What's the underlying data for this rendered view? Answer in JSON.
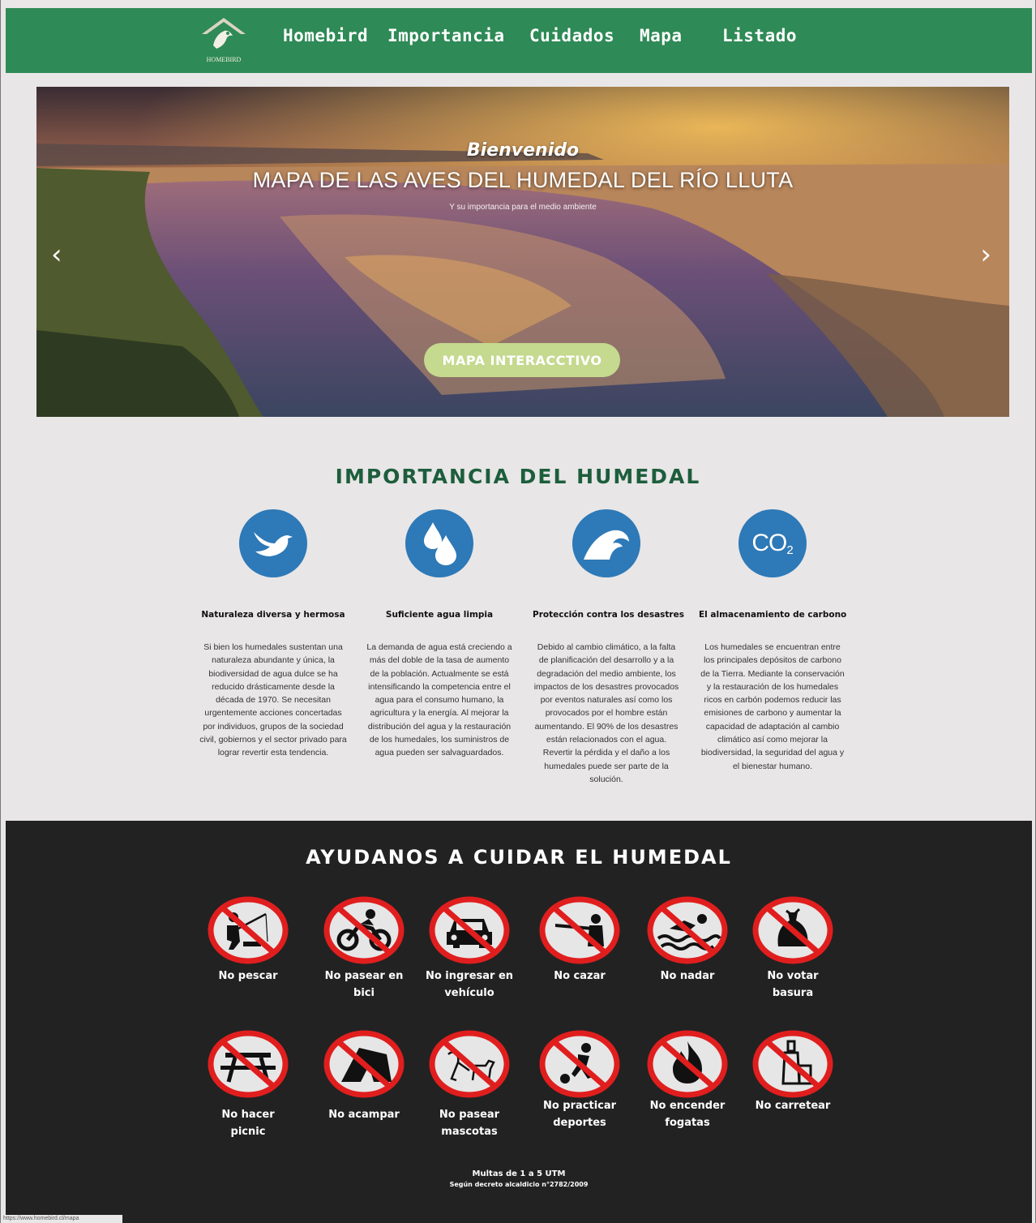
{
  "nav": {
    "logo_text": "HOMEBIRD",
    "links": [
      {
        "label": "Homebird"
      },
      {
        "label": "Importancia"
      },
      {
        "label": "Cuidados"
      },
      {
        "label": "Mapa"
      },
      {
        "label": "Listado"
      }
    ]
  },
  "hero": {
    "welcome": "Bienvenido",
    "title": "MAPA DE LAS AVES DEL HUMEDAL DEL RÍO LLUTA",
    "subtitle": "Y su importancia para el medio ambiente",
    "button": "MAPA INTERACCTIVO",
    "prev_arrow": "‹",
    "next_arrow": "›"
  },
  "importance": {
    "title": "IMPORTANCIA DEL HUMEDAL",
    "items": [
      {
        "icon": "bird-icon",
        "heading": "Naturaleza diversa y hermosa",
        "text": "Si bien los humedales sustentan una naturaleza abundante y única, la biodiversidad de agua dulce se ha reducido drásticamente desde la década de 1970. Se necesitan urgentemente acciones concertadas por individuos, grupos de la sociedad civil, gobiernos y el sector privado para lograr revertir esta tendencia."
      },
      {
        "icon": "water-drops-icon",
        "heading": "Suficiente agua limpia",
        "text": "La demanda de agua está creciendo a más del doble de la tasa de aumento de la población. Actualmente se está intensificando la competencia entre el agua para el consumo humano, la agricultura y la energía. Al mejorar la distribución del agua y la restauración de los humedales, los suministros de agua pueden ser salvaguardados."
      },
      {
        "icon": "wave-icon",
        "heading": "Protección contra los desastres",
        "text": "Debido al cambio climático, a la falta de planificación del desarrollo y a la degradación del medio ambiente, los impactos de los desastres provocados por eventos naturales así como los provocados por el hombre están aumentando. El 90% de los desastres están relacionados con el agua. Revertir la pérdida y el daño a los humedales puede ser parte de la solución."
      },
      {
        "icon": "co2-icon",
        "co2": "CO",
        "co2_sub": "2",
        "heading": "El almacenamiento de carbono",
        "text": "Los humedales se encuentran entre los principales depósitos de carbono de la Tierra. Mediante la conservación y la restauración de los humedales ricos en carbón podemos reducir las emisiones de carbono y aumentar la capacidad de adaptación al cambio climático así como mejorar la biodiversidad, la seguridad del agua y el bienestar humano."
      }
    ]
  },
  "care": {
    "title": "AYUDANOS A CUIDAR EL HUMEDAL",
    "rules": [
      {
        "icon": "no-fishing-icon",
        "line1": "No pescar",
        "line2": ""
      },
      {
        "icon": "no-bike-icon",
        "line1": "No pasear en",
        "line2": "bici"
      },
      {
        "icon": "no-vehicle-icon",
        "line1": "No ingresar en",
        "line2": "vehículo"
      },
      {
        "icon": "no-hunting-icon",
        "line1": "No cazar",
        "line2": ""
      },
      {
        "icon": "no-swimming-icon",
        "line1": "No nadar",
        "line2": ""
      },
      {
        "icon": "no-littering-icon",
        "line1": "No votar",
        "line2": "basura"
      },
      {
        "icon": "no-picnic-icon",
        "line1": "No hacer",
        "line2": "picnic"
      },
      {
        "icon": "no-camping-icon",
        "line1": "No acampar",
        "line2": ""
      },
      {
        "icon": "no-pets-icon",
        "line1": "No pasear",
        "line2": "mascotas"
      },
      {
        "icon": "no-sports-icon",
        "line1": "No practicar",
        "line2": "deportes"
      },
      {
        "icon": "no-fire-icon",
        "line1": "No encender",
        "line2": "fogatas"
      },
      {
        "icon": "no-party-icon",
        "line1": "No carretear",
        "line2": ""
      }
    ],
    "fine_line1": "Multas de 1 a 5 UTM",
    "fine_line2": "Según decreto alcaldicio n°2782/2009"
  },
  "status_url": "https://www.homebird.cl/mapa",
  "colors": {
    "nav": "#2e8a56",
    "accent_green": "#1d5e3c",
    "icon_blue": "#2e79b7",
    "button": "#c5d98f",
    "prohibit_red": "#e01e1e",
    "dark_bg": "#222222"
  }
}
